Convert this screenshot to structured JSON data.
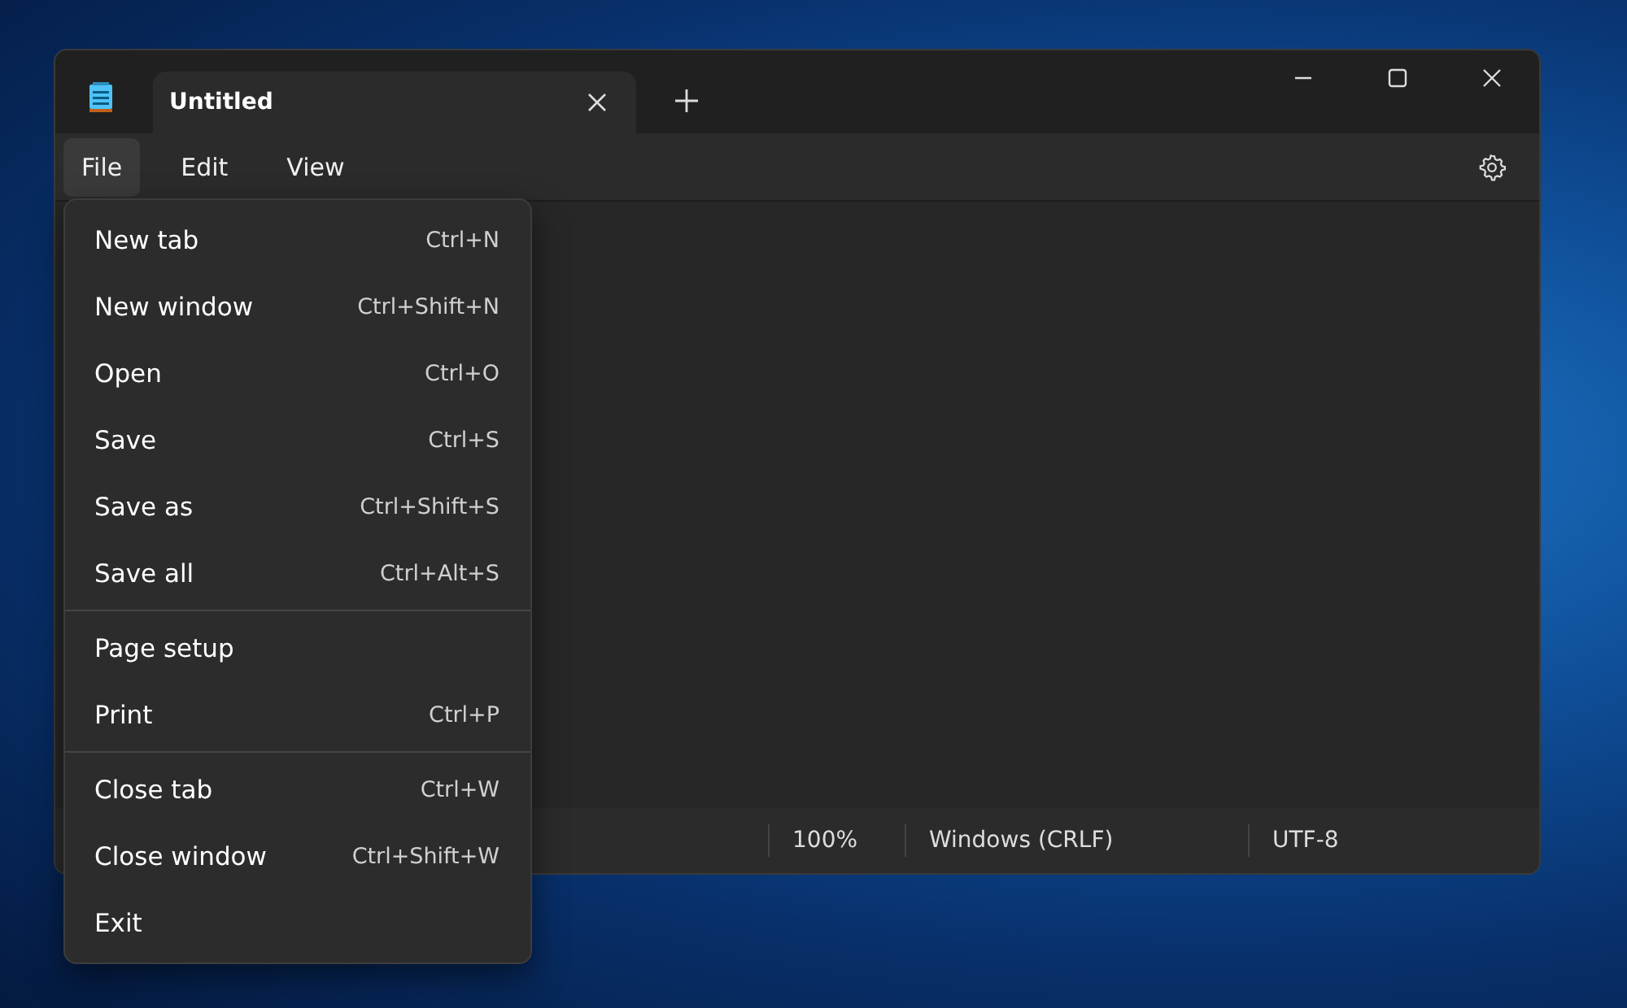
{
  "window": {
    "tabs": [
      {
        "title": "Untitled"
      }
    ]
  },
  "menu_bar": [
    {
      "label": "File",
      "selected": true
    },
    {
      "label": "Edit",
      "selected": false
    },
    {
      "label": "View",
      "selected": false
    }
  ],
  "file_menu": {
    "groups": [
      [
        {
          "label": "New tab",
          "shortcut": "Ctrl+N"
        },
        {
          "label": "New window",
          "shortcut": "Ctrl+Shift+N"
        },
        {
          "label": "Open",
          "shortcut": "Ctrl+O"
        },
        {
          "label": "Save",
          "shortcut": "Ctrl+S"
        },
        {
          "label": "Save as",
          "shortcut": "Ctrl+Shift+S"
        },
        {
          "label": "Save all",
          "shortcut": "Ctrl+Alt+S"
        }
      ],
      [
        {
          "label": "Page setup"
        },
        {
          "label": "Print",
          "shortcut": "Ctrl+P"
        }
      ],
      [
        {
          "label": "Close tab",
          "shortcut": "Ctrl+W"
        },
        {
          "label": "Close window",
          "shortcut": "Ctrl+Shift+W"
        },
        {
          "label": "Exit"
        }
      ]
    ]
  },
  "status_bar": {
    "zoom": "100%",
    "line_ending": "Windows (CRLF)",
    "encoding": "UTF-8"
  }
}
